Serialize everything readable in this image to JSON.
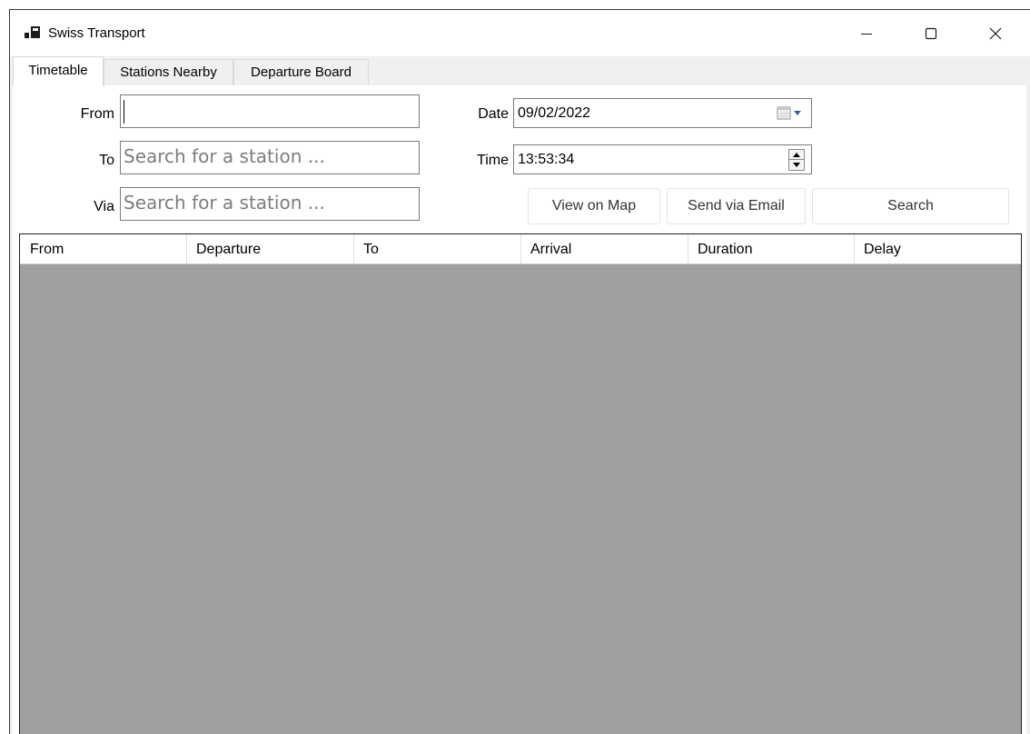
{
  "window": {
    "title": "Swiss Transport",
    "app_icon": "app-window-icon",
    "controls": {
      "minimize_icon": "minimize-icon",
      "maximize_icon": "maximize-icon",
      "close_icon": "close-icon"
    }
  },
  "tabs": [
    {
      "label": "Timetable",
      "active": true
    },
    {
      "label": "Stations Nearby",
      "active": false
    },
    {
      "label": "Departure Board",
      "active": false
    }
  ],
  "form": {
    "from": {
      "label": "From",
      "value": "",
      "placeholder": ""
    },
    "to": {
      "label": "To",
      "value": "",
      "placeholder": "Search for a station ..."
    },
    "via": {
      "label": "Via",
      "value": "",
      "placeholder": "Search for a station ..."
    },
    "date": {
      "label": "Date",
      "value": "09/02/2022",
      "icon": "calendar-dropdown-icon"
    },
    "time": {
      "label": "Time",
      "value": "13:53:34",
      "icon": "spin-updown-icon"
    }
  },
  "buttons": {
    "view_map": "View on Map",
    "send_email": "Send via Email",
    "search": "Search"
  },
  "grid": {
    "columns": [
      "From",
      "Departure",
      "To",
      "Arrival",
      "Duration",
      "Delay"
    ],
    "rows": []
  },
  "colors": {
    "grid_background": "#a0a0a0",
    "window_frame": "#f0f0f0"
  }
}
